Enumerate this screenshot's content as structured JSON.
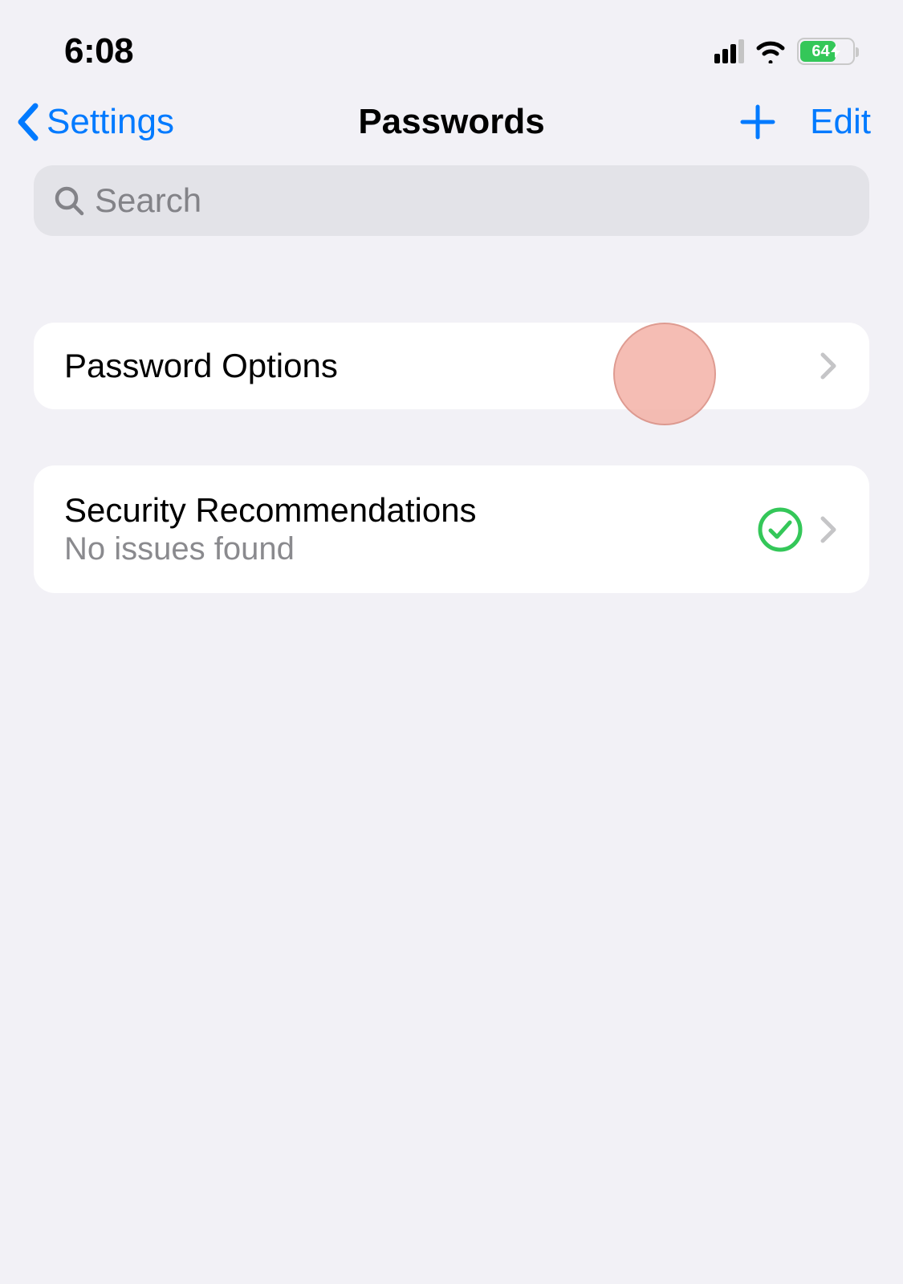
{
  "status": {
    "time": "6:08",
    "battery_percent": "64"
  },
  "nav": {
    "back_label": "Settings",
    "title": "Passwords",
    "edit_label": "Edit"
  },
  "search": {
    "placeholder": "Search"
  },
  "rows": {
    "password_options": {
      "title": "Password Options"
    },
    "security_recs": {
      "title": "Security Recommendations",
      "detail": "No issues found"
    }
  },
  "colors": {
    "accent": "#007aff",
    "success": "#34c759",
    "background": "#f2f1f6"
  }
}
